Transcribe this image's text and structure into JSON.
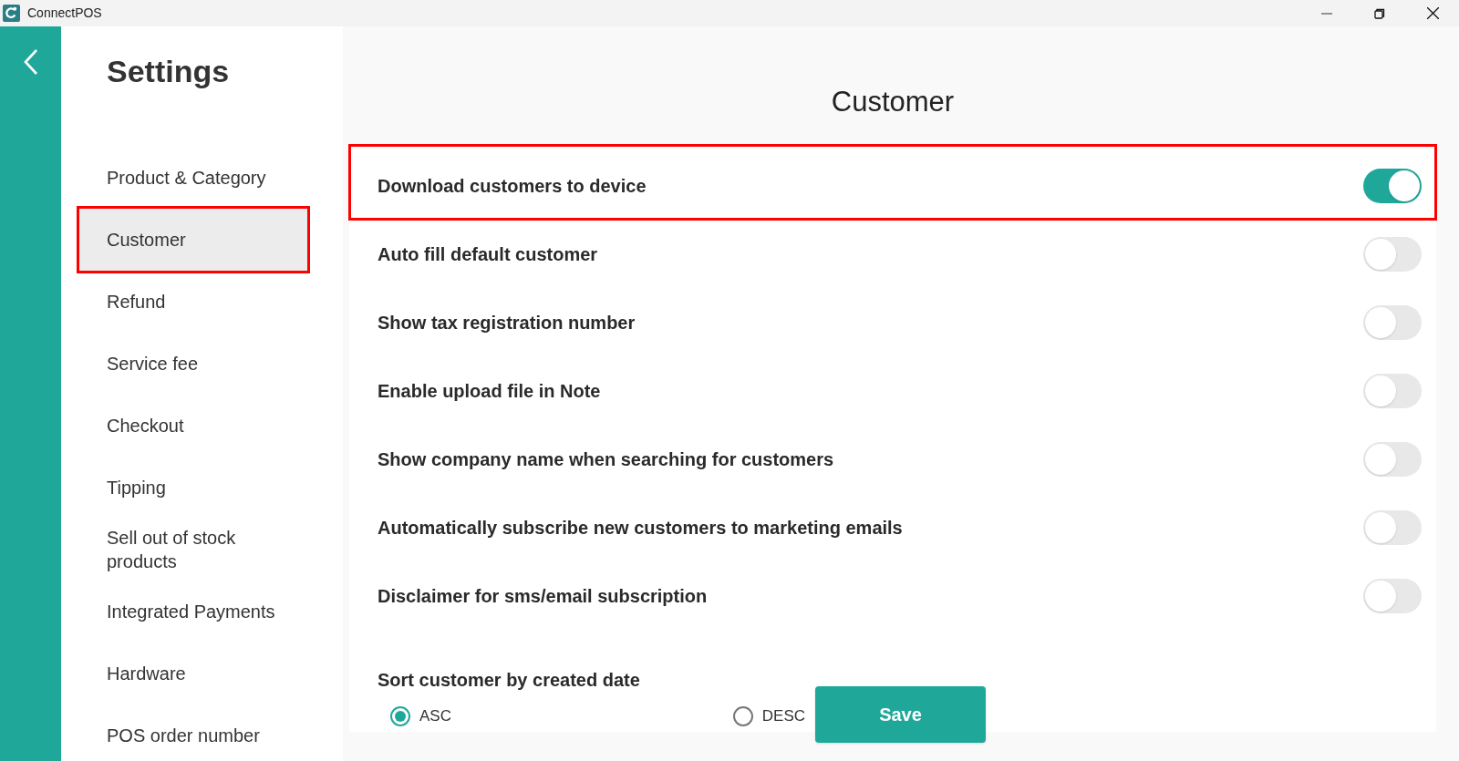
{
  "window": {
    "title": "ConnectPOS"
  },
  "sidebar": {
    "title": "Settings",
    "items": [
      {
        "label": "Product & Category",
        "selected": false,
        "highlighted": false
      },
      {
        "label": "Customer",
        "selected": true,
        "highlighted": true
      },
      {
        "label": "Refund",
        "selected": false,
        "highlighted": false
      },
      {
        "label": "Service fee",
        "selected": false,
        "highlighted": false
      },
      {
        "label": "Checkout",
        "selected": false,
        "highlighted": false
      },
      {
        "label": "Tipping",
        "selected": false,
        "highlighted": false
      },
      {
        "label": "Sell out of stock products",
        "selected": false,
        "highlighted": false
      },
      {
        "label": "Integrated Payments",
        "selected": false,
        "highlighted": false
      },
      {
        "label": "Hardware",
        "selected": false,
        "highlighted": false
      },
      {
        "label": "POS order number",
        "selected": false,
        "highlighted": false
      }
    ]
  },
  "content": {
    "title": "Customer",
    "settings": [
      {
        "label": "Download customers to device",
        "on": true,
        "highlighted": true
      },
      {
        "label": "Auto fill default customer",
        "on": false,
        "highlighted": false
      },
      {
        "label": "Show tax registration number",
        "on": false,
        "highlighted": false
      },
      {
        "label": "Enable upload file in Note",
        "on": false,
        "highlighted": false
      },
      {
        "label": "Show company name when searching for customers",
        "on": false,
        "highlighted": false
      },
      {
        "label": "Automatically subscribe new customers to marketing emails",
        "on": false,
        "highlighted": false
      },
      {
        "label": "Disclaimer for sms/email subscription",
        "on": false,
        "highlighted": false
      }
    ],
    "sort": {
      "label": "Sort customer by created date",
      "options": [
        {
          "label": "ASC",
          "selected": true
        },
        {
          "label": "DESC",
          "selected": false
        }
      ]
    },
    "save_button": "Save"
  }
}
